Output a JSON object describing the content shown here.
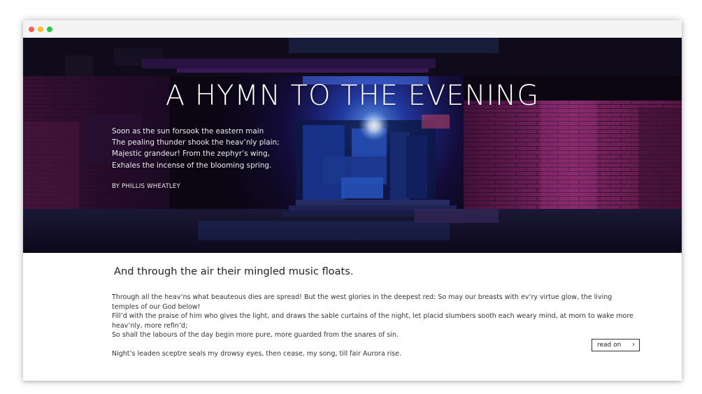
{
  "hero": {
    "title": "A HYMN TO THE EVENING",
    "poem_lines": [
      "Soon as the sun forsook the eastern main",
      "The pealing thunder shook the heav’nly plain;",
      "Majestic grandeur! From the zephyr’s wing,",
      "Exhales the incense of the blooming spring."
    ],
    "byline": "BY PHILLIS WHEATLEY"
  },
  "content": {
    "subheading": "And through the air their mingled music floats.",
    "paragraphs": [
      "Through all the heav’ns what beauteous dies are spread! But the west glories in the deepest red: So may our breasts with ev’ry virtue glow, the living temples of our God below!",
      "Fill’d with the praise of him who gives the light, and draws the sable curtains of the night, let placid slumbers sooth each weary mind, at morn to wake more heav’nly, more refin’d;",
      "So shall the labours of the day begin more pure, more guarded from the snares of sin."
    ],
    "final_line": "Night’s leaden sceptre seals my drowsy eyes, then cease, my song, till fair Aurora rise.",
    "read_on_label": "read on",
    "read_on_icon": "chevron-right-icon"
  },
  "colors": {
    "window_dot_red": "#fd5f56",
    "window_dot_yellow": "#febc2e",
    "window_dot_green": "#28c840",
    "hero_accent_blue": "#3a6cff",
    "hero_accent_magenta": "#b03a90"
  }
}
